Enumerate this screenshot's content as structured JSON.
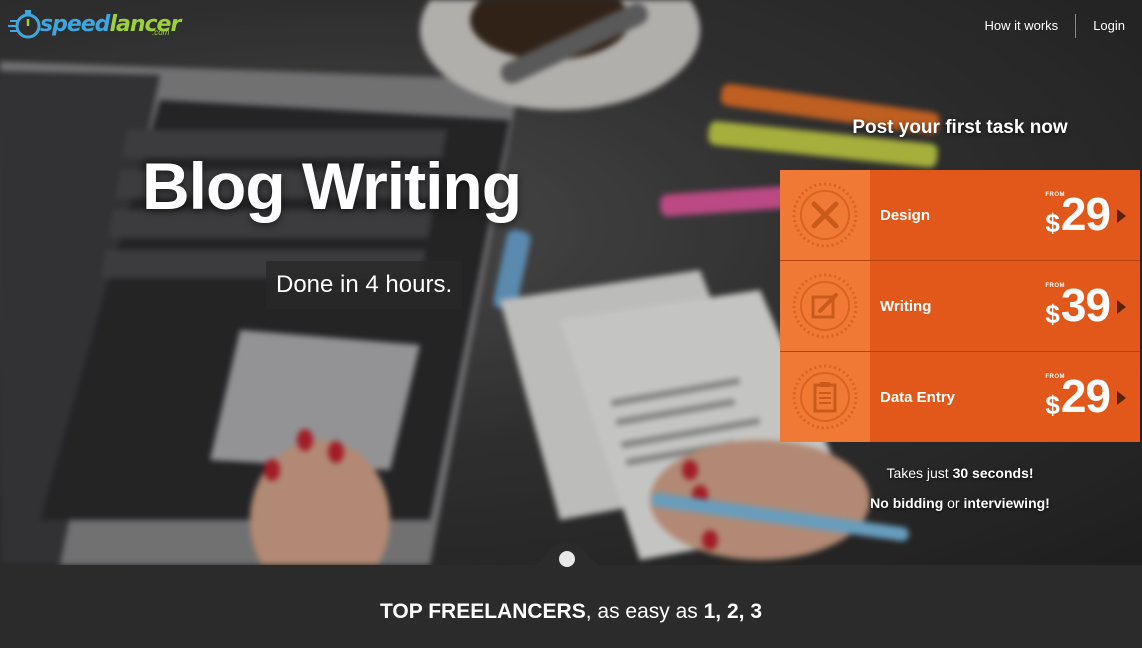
{
  "header": {
    "logo_part1": "speed",
    "logo_part2": "lancer",
    "logo_sub": ".com",
    "nav": [
      {
        "label": "How it works"
      },
      {
        "label": "Login"
      }
    ]
  },
  "hero": {
    "headline": "Blog Writing",
    "tagline": "Done in 4 hours."
  },
  "panel": {
    "title": "Post your first task now",
    "tasks": [
      {
        "label": "Design",
        "from": "FROM",
        "currency": "$",
        "price": "29",
        "icon": "design-tools-icon"
      },
      {
        "label": "Writing",
        "from": "FROM",
        "currency": "$",
        "price": "39",
        "icon": "edit-document-icon"
      },
      {
        "label": "Data Entry",
        "from": "FROM",
        "currency": "$",
        "price": "29",
        "icon": "clipboard-icon"
      }
    ],
    "note1_pre": "Takes just ",
    "note1_bold": "30 seconds!",
    "note2_bold1": "No bidding",
    "note2_mid": " or ",
    "note2_bold2": "interviewing!"
  },
  "band": {
    "bold1": "TOP FREELANCERS",
    "mid": ", as easy as ",
    "bold2": "1, 2, 3"
  },
  "colors": {
    "accent": "#e2581a",
    "accent_light": "#f07a35",
    "logo_blue": "#3ea6e0",
    "logo_green": "#9bd13a",
    "band_bg": "#2b2b2b"
  }
}
